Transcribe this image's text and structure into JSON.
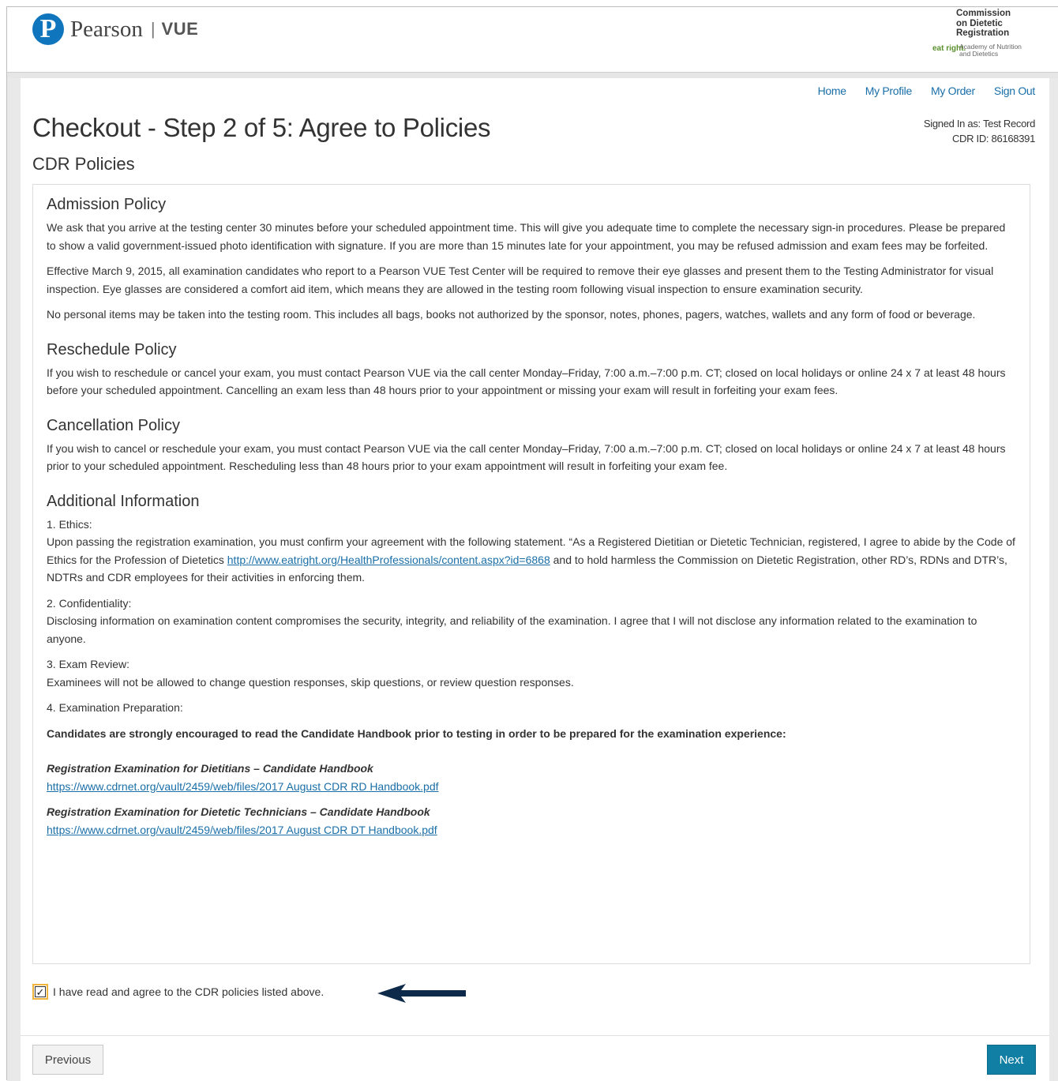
{
  "header": {
    "brand_name": "Pearson",
    "brand_sep": "|",
    "brand_product": "VUE",
    "partner_title": "Commission on Dietetic Registration",
    "partner_eat": "eat right.",
    "partner_academy": "Academy of Nutrition and Dietetics"
  },
  "nav": {
    "home": "Home",
    "profile": "My Profile",
    "order": "My Order",
    "signout": "Sign Out"
  },
  "user": {
    "signed_in": "Signed In as: Test Record",
    "cdr_id": "CDR ID: 86168391"
  },
  "page": {
    "title": "Checkout - Step 2 of 5: Agree to Policies",
    "subtitle": "CDR Policies"
  },
  "policies": {
    "admission": {
      "heading": "Admission Policy",
      "p1": "We ask that you arrive at the testing center 30 minutes before your scheduled appointment time. This will give you adequate time to complete the necessary sign-in procedures. Please be prepared to show a valid government-issued photo identification with signature. If you are more than 15 minutes late for your appointment, you may be refused admission and exam fees may be forfeited.",
      "p2": "Effective March 9, 2015, all examination candidates who report to a Pearson VUE Test Center will be required to remove their eye glasses and present them to the Testing Administrator for visual inspection. Eye glasses are considered a comfort aid item, which means they are allowed in the testing room following visual inspection to ensure examination security.",
      "p3": "No personal items may be taken into the testing room. This includes all bags, books not authorized by the sponsor, notes, phones, pagers, watches, wallets and any form of food or beverage."
    },
    "reschedule": {
      "heading": "Reschedule Policy",
      "p1": "If you wish to reschedule or cancel your exam, you must contact Pearson VUE via the call center Monday–Friday, 7:00 a.m.–7:00 p.m. CT; closed on local holidays or online 24 x 7 at least 48 hours before your scheduled appointment. Cancelling an exam less than 48 hours prior to your appointment or missing your exam will result in forfeiting your exam fees."
    },
    "cancellation": {
      "heading": "Cancellation Policy",
      "p1": "If you wish to cancel or reschedule your exam, you must contact Pearson VUE via the call center Monday–Friday, 7:00 a.m.–7:00 p.m. CT; closed on local holidays or online 24 x 7 at least 48 hours prior to your scheduled appointment. Rescheduling less than 48 hours prior to your exam appointment will result in forfeiting your exam fee."
    },
    "additional": {
      "heading": "Additional Information",
      "ethics_label": "1. Ethics:",
      "ethics_text_a": "Upon passing the registration examination, you must confirm your agreement with the following statement. “As a Registered Dietitian or Dietetic Technician, registered, I agree to abide by the Code of Ethics for the Profession of Dietetics ",
      "ethics_link": "http://www.eatright.org/HealthProfessionals/content.aspx?id=6868",
      "ethics_text_b": " and to hold harmless the Commission on Dietetic Registration, other RD’s, RDNs and DTR’s, NDTRs and CDR employees for their activities in enforcing them.",
      "conf_label": "2. Confidentiality:",
      "conf_text": "Disclosing information on examination content compromises the security, integrity, and reliability of the examination. I agree that I will not disclose any information related to the examination to anyone.",
      "review_label": "3. Exam Review:",
      "review_text": "Examinees will not be allowed to change question responses, skip questions, or review question responses.",
      "prep_label": "4. Examination Preparation:",
      "prep_bold": "Candidates are strongly encouraged to read the Candidate Handbook prior to testing in order to be prepared for the examination experience:",
      "rd_title": "Registration Examination for Dietitians – Candidate Handbook",
      "rd_link": "https://www.cdrnet.org/vault/2459/web/files/2017 August CDR RD Handbook.pdf",
      "dt_title": "Registration Examination for Dietetic Technicians – Candidate Handbook",
      "dt_link": "https://www.cdrnet.org/vault/2459/web/files/2017 August CDR DT Handbook.pdf"
    }
  },
  "agreement": {
    "checked": true,
    "check_glyph": "✓",
    "label": "I have read and agree to the CDR policies listed above."
  },
  "buttons": {
    "previous": "Previous",
    "next": "Next"
  },
  "colors": {
    "link": "#1a6fa8",
    "primary_button": "#117fa3",
    "checkbox_highlight": "#f0b43c",
    "arrow": "#0e2a4a"
  }
}
